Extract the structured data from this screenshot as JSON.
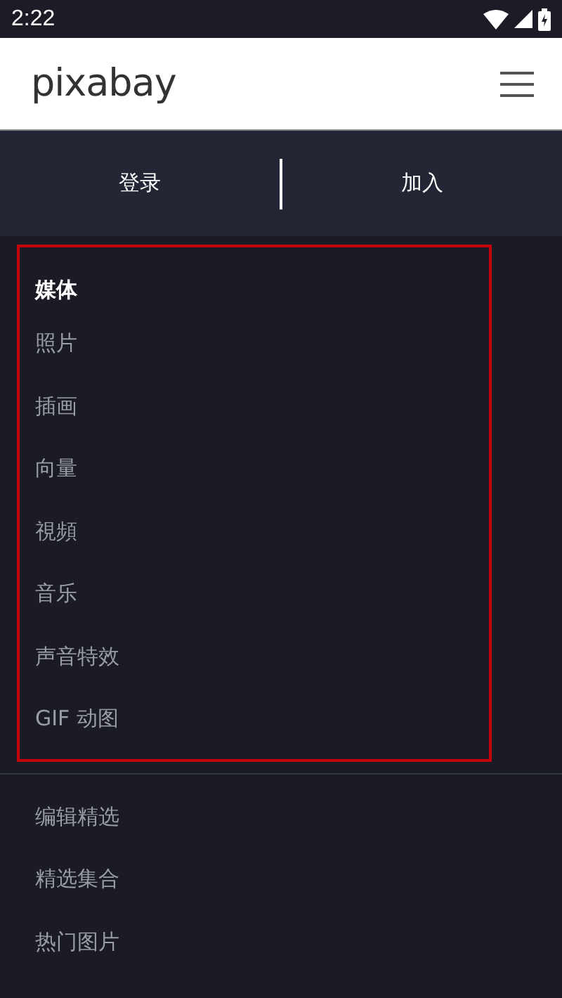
{
  "status_bar": {
    "time": "2:22"
  },
  "header": {
    "logo": "pixabay"
  },
  "auth": {
    "buttons": [
      "登录",
      "加入"
    ]
  },
  "media_menu": {
    "heading": "媒体",
    "items": [
      "照片",
      "插画",
      "向量",
      "視頻",
      "音乐",
      "声音特效",
      "GIF 动图"
    ]
  },
  "more_menu": {
    "items": [
      "编辑精选",
      "精选集合",
      "热门图片"
    ]
  }
}
